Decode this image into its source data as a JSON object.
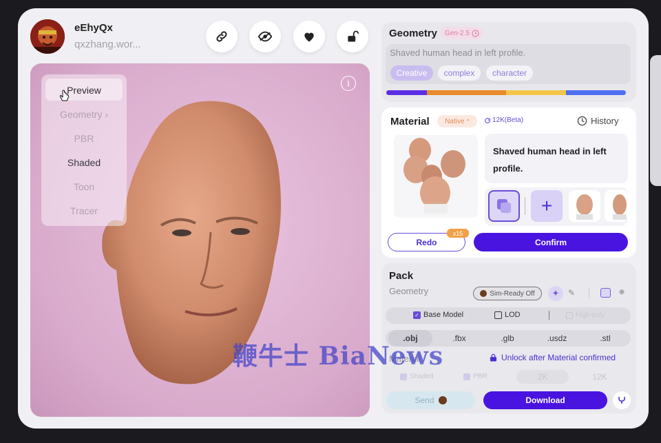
{
  "user": {
    "name": "eEhyQx",
    "email": "qxzhang.wor..."
  },
  "header_buttons": [
    "link-icon",
    "eye-slash-icon",
    "heart-icon",
    "unlock-icon"
  ],
  "view_menu": {
    "items": [
      "Preview",
      "Geometry",
      "PBR",
      "Shaded",
      "Toon",
      "Tracer"
    ],
    "active": "Preview",
    "geometry_arrow": "›"
  },
  "viewport": {
    "info_glyph": "i"
  },
  "geometry": {
    "title": "Geometry",
    "version_tag": "Gen-2.5",
    "prompt": "Shaved human head in left profile.",
    "tags": [
      "Creative",
      "complex",
      "character"
    ]
  },
  "material": {
    "title": "Material",
    "mode_tag": "Native",
    "resolution_tag": "12K(Beta)",
    "history_label": "History",
    "prompt_line1": "Shaved human head in left",
    "prompt_line2": "profile.",
    "add_glyph": "+",
    "redo_label": "Redo",
    "redo_badge": "x15",
    "confirm_label": "Confirm"
  },
  "pack": {
    "title": "Pack",
    "geometry_label": "Geometry",
    "sim_ready_label": "Sim-Ready Off",
    "base_model_label": "Base Model",
    "lod_label": "LOD",
    "high_poly_label": "High-poly",
    "formats": [
      ".obj",
      ".fbx",
      ".glb",
      ".usdz",
      ".stl"
    ],
    "selected_format": ".obj",
    "material_label": "Material",
    "unlock_text": "Unlock after Material confirmed",
    "shaded_label": "Shaded",
    "pbr_label": "PBR",
    "res_2k": "2K",
    "res_12k": "12K",
    "send_label": "Send",
    "download_label": "Download"
  },
  "watermark_text": "鞭牛士 BiaNews",
  "colors": {
    "accent": "#4a14e0",
    "tag_bg": "#c9bdf0",
    "progress": [
      "#5b2ee3",
      "#e98b2a",
      "#f3c64a",
      "#4f6ef0"
    ]
  }
}
